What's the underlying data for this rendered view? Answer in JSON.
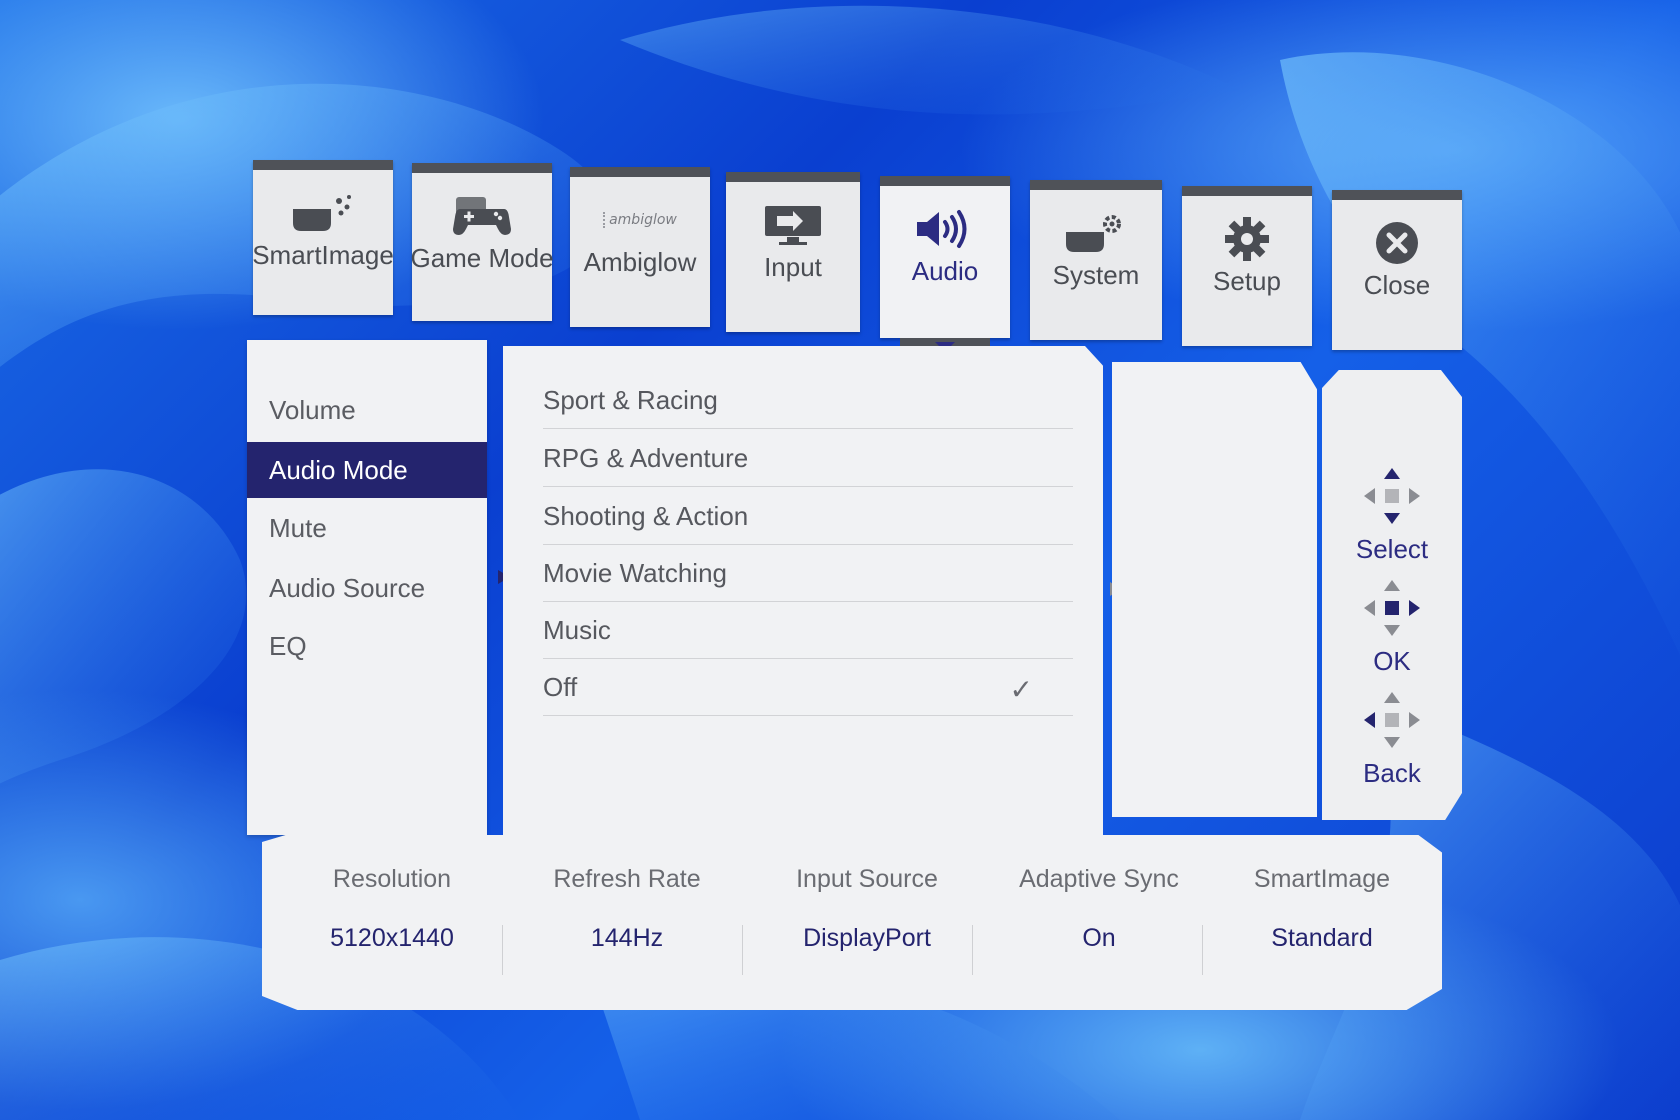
{
  "tabs": [
    {
      "label": "SmartImage",
      "icon": "smartimage-icon",
      "active": false
    },
    {
      "label": "Game Mode",
      "icon": "gamepad-icon",
      "active": false
    },
    {
      "label": "Ambiglow",
      "icon": "ambiglow-logo-icon",
      "icon_text": "ambiglow",
      "active": false
    },
    {
      "label": "Input",
      "icon": "input-icon",
      "active": false
    },
    {
      "label": "Audio",
      "icon": "speaker-icon",
      "active": true
    },
    {
      "label": "System",
      "icon": "system-icon",
      "active": false
    },
    {
      "label": "Setup",
      "icon": "gear-icon",
      "active": false
    },
    {
      "label": "Close",
      "icon": "close-icon",
      "active": false
    }
  ],
  "audio_menu": {
    "items": [
      "Volume",
      "Audio Mode",
      "Mute",
      "Audio Source",
      "EQ"
    ],
    "selected": "Audio Mode"
  },
  "audio_mode_options": {
    "items": [
      "Sport & Racing",
      "RPG & Adventure",
      "Shooting & Action",
      "Movie Watching",
      "Music",
      "Off"
    ],
    "checked": "Off",
    "check_mark": "✓"
  },
  "nav": {
    "select_label": "Select",
    "ok_label": "OK",
    "back_label": "Back"
  },
  "info_bar": {
    "columns": [
      {
        "label": "Resolution",
        "value": "5120x1440"
      },
      {
        "label": "Refresh Rate",
        "value": "144Hz"
      },
      {
        "label": "Input Source",
        "value": "DisplayPort"
      },
      {
        "label": "Adaptive Sync",
        "value": "On"
      },
      {
        "label": "SmartImage",
        "value": "Standard"
      }
    ]
  },
  "colors": {
    "accent": "#24246e",
    "panel": "#f1f2f4",
    "tile_header": "#4f5258",
    "wallpaper_blue": "#0a3fd0"
  }
}
